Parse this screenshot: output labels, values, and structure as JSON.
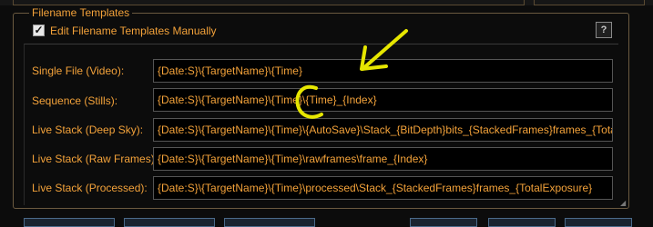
{
  "group": {
    "title": "Filename Templates"
  },
  "edit_manually": {
    "label": "Edit Filename Templates Manually",
    "checked": true
  },
  "help_button": {
    "label": "?"
  },
  "templates": [
    {
      "label": "Single File (Video):",
      "value": "{Date:S}\\{TargetName}\\{Time}"
    },
    {
      "label": "Sequence (Stills):",
      "value": "{Date:S}\\{TargetName}\\{Time}\\{Time}_{Index}"
    },
    {
      "label": "Live Stack (Deep Sky):",
      "value": "{Date:S}\\{TargetName}\\{Time}\\{AutoSave}\\Stack_{BitDepth}bits_{StackedFrames}frames_{TotalExposure}s"
    },
    {
      "label": "Live Stack (Raw Frames):",
      "value": "{Date:S}\\{TargetName}\\{Time}\\rawframes\\frame_{Index}"
    },
    {
      "label": "Live Stack (Processed):",
      "value": "{Date:S}\\{TargetName}\\{Time}\\processed\\Stack_{StackedFrames}frames_{TotalExposure}"
    }
  ],
  "colors": {
    "text": "#f3a23a",
    "background": "#0c0c0c",
    "field_background": "#000000",
    "annotation": "#e6e600"
  },
  "icons": {
    "checkbox": "checkmark-icon",
    "annotation_arrow": "arrow-annotation-icon",
    "annotation_circle": "circle-annotation-icon"
  }
}
